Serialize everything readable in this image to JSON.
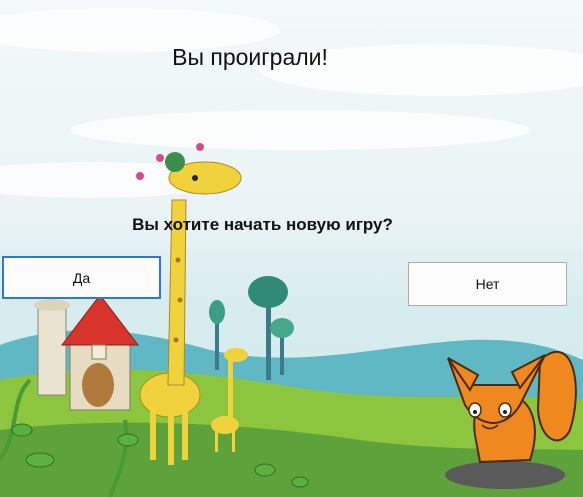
{
  "dialog": {
    "title": "Вы проиграли!",
    "question": "Вы хотите начать новую игру?",
    "yes_label": "Да",
    "no_label": "Нет"
  },
  "background": {
    "characters": [
      "giraffe",
      "small-giraffe",
      "fox"
    ],
    "objects": [
      "mushroom-house",
      "trees",
      "hills",
      "vines"
    ]
  }
}
